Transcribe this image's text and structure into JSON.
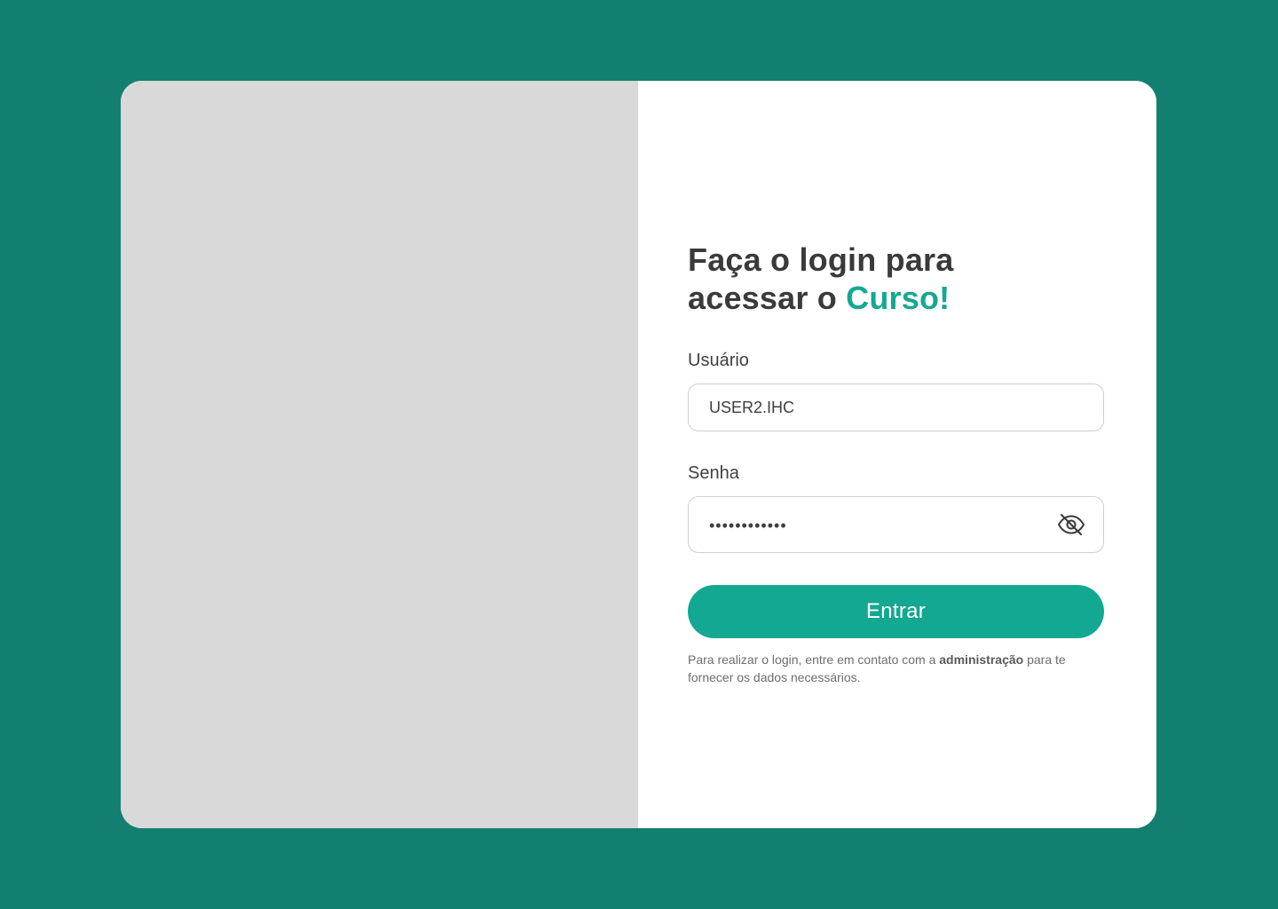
{
  "colors": {
    "page_background": "#137f70",
    "accent": "#13a891",
    "placeholder_panel": "#d9d9d9",
    "title_text": "#3a3a3a"
  },
  "login": {
    "title_line1": "Faça o login para",
    "title_line2_prefix": "acessar o ",
    "title_highlight": "Curso!",
    "username_label": "Usuário",
    "username_value": "USER2.IHC",
    "password_label": "Senha",
    "password_masked": "••••••••••••",
    "password_toggle_icon": "eye-off-icon",
    "submit_label": "Entrar",
    "hint_prefix": "Para realizar o login, entre em contato com a ",
    "hint_bold": "administração",
    "hint_suffix": " para te fornecer os dados necessários."
  }
}
